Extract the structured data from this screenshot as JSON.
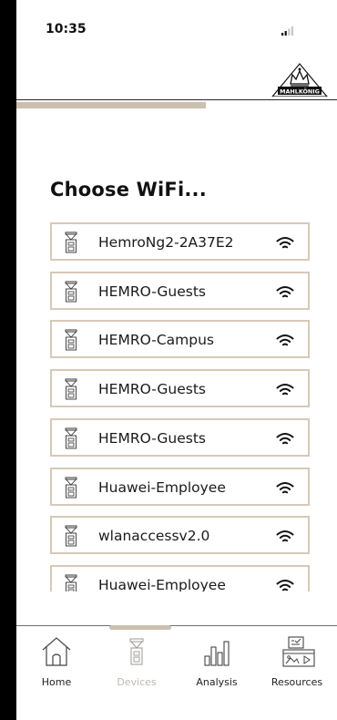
{
  "status_bar": {
    "time": "10:35"
  },
  "brand": {
    "logo_text": "MAHLKÖNIG"
  },
  "setup_progress": {
    "fraction": 0.59
  },
  "page": {
    "title": "Choose WiFi..."
  },
  "networks": [
    {
      "ssid": "HemroNg2-2A37E2"
    },
    {
      "ssid": "HEMRO-Guests"
    },
    {
      "ssid": "HEMRO-Campus"
    },
    {
      "ssid": "HEMRO-Guests"
    },
    {
      "ssid": "HEMRO-Guests"
    },
    {
      "ssid": "Huawei-Employee"
    },
    {
      "ssid": "wlanaccessv2.0"
    },
    {
      "ssid": "Huawei-Employee"
    }
  ],
  "nav": {
    "active": "devices",
    "items": [
      {
        "id": "home",
        "label": "Home",
        "icon": "home-icon"
      },
      {
        "id": "devices",
        "label": "Devices",
        "icon": "grinder-icon"
      },
      {
        "id": "analysis",
        "label": "Analysis",
        "icon": "bar-chart-icon"
      },
      {
        "id": "resources",
        "label": "Resources",
        "icon": "resources-icon"
      }
    ]
  },
  "colors": {
    "accent": "#cbbfae",
    "row_border": "#d7c9b7",
    "inactive_label": "#bfb9b1"
  }
}
